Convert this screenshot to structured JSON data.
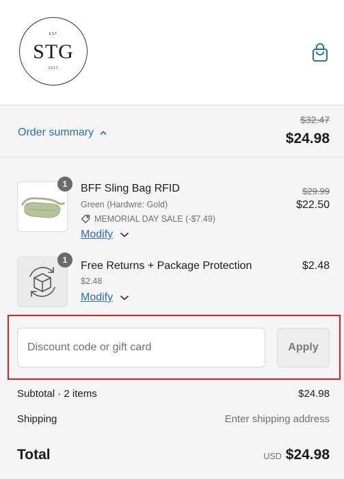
{
  "logo": {
    "est": "EST",
    "name": "STG",
    "year": "2017"
  },
  "header": {
    "cart_icon": "shopping-bag-icon"
  },
  "summary": {
    "toggle_label": "Order summary",
    "original_total": "$32.47",
    "total": "$24.98"
  },
  "items": [
    {
      "quantity": "1",
      "title": "BFF Sling Bag RFID",
      "variant": "Green (Hardwre: Gold)",
      "discount": "MEMORIAL DAY SALE (-$7.49)",
      "modify_label": "Modify",
      "original_price": "$29.99",
      "price": "$22.50"
    },
    {
      "quantity": "1",
      "title": "Free Returns + Package Protection",
      "variant": "$2.48",
      "modify_label": "Modify",
      "price": "$2.48"
    }
  ],
  "discount": {
    "placeholder": "Discount code or gift card",
    "apply_label": "Apply"
  },
  "totals": {
    "subtotal_label": "Subtotal · 2 items",
    "subtotal_value": "$24.98",
    "shipping_label": "Shipping",
    "shipping_value": "Enter shipping address",
    "total_label": "Total",
    "currency": "USD",
    "total_value": "$24.98"
  },
  "colors": {
    "link": "#2b6fb3",
    "highlight": "#e01e1e",
    "background": "#f5f5f5"
  }
}
